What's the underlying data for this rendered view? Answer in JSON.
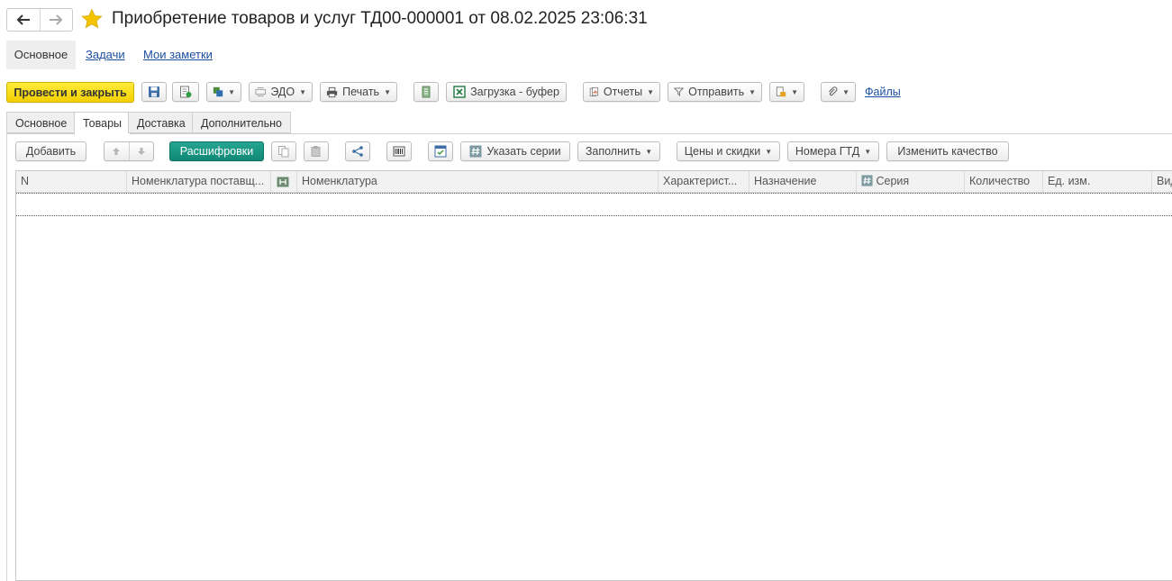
{
  "window": {
    "title": "Приобретение товаров и услуг ТД00-000001 от 08.02.2025 23:06:31"
  },
  "top_tabs": [
    {
      "label": "Основное"
    },
    {
      "label": "Задачи"
    },
    {
      "label": "Мои заметки"
    }
  ],
  "toolbar": {
    "post_close": "Провести и закрыть",
    "edo": "ЭДО",
    "print": "Печать",
    "load_buffer": "Загрузка - буфер",
    "reports": "Отчеты",
    "send": "Отправить",
    "files": "Файлы"
  },
  "doc_tabs": [
    {
      "label": "Основное"
    },
    {
      "label": "Товары"
    },
    {
      "label": "Доставка"
    },
    {
      "label": "Дополнительно"
    }
  ],
  "goods_toolbar": {
    "add": "Добавить",
    "decode": "Расшифровки",
    "set_series": "Указать серии",
    "fill": "Заполнить",
    "prices": "Цены и скидки",
    "gtd": "Номера ГТД",
    "quality": "Изменить качество"
  },
  "table": {
    "columns": [
      {
        "label": "N"
      },
      {
        "label": "Номенклатура поставщ..."
      },
      {
        "label": ""
      },
      {
        "label": "Номенклатура"
      },
      {
        "label": "Характерист..."
      },
      {
        "label": "Назначение"
      },
      {
        "label": "Серия"
      },
      {
        "label": "Количество"
      },
      {
        "label": "Ед. изм."
      },
      {
        "label": "Вид"
      }
    ],
    "rows": []
  },
  "colors": {
    "primary_yellow": "#f5d70a",
    "teal": "#1a9783",
    "link": "#1b4ea0",
    "star": "#f4c400"
  }
}
